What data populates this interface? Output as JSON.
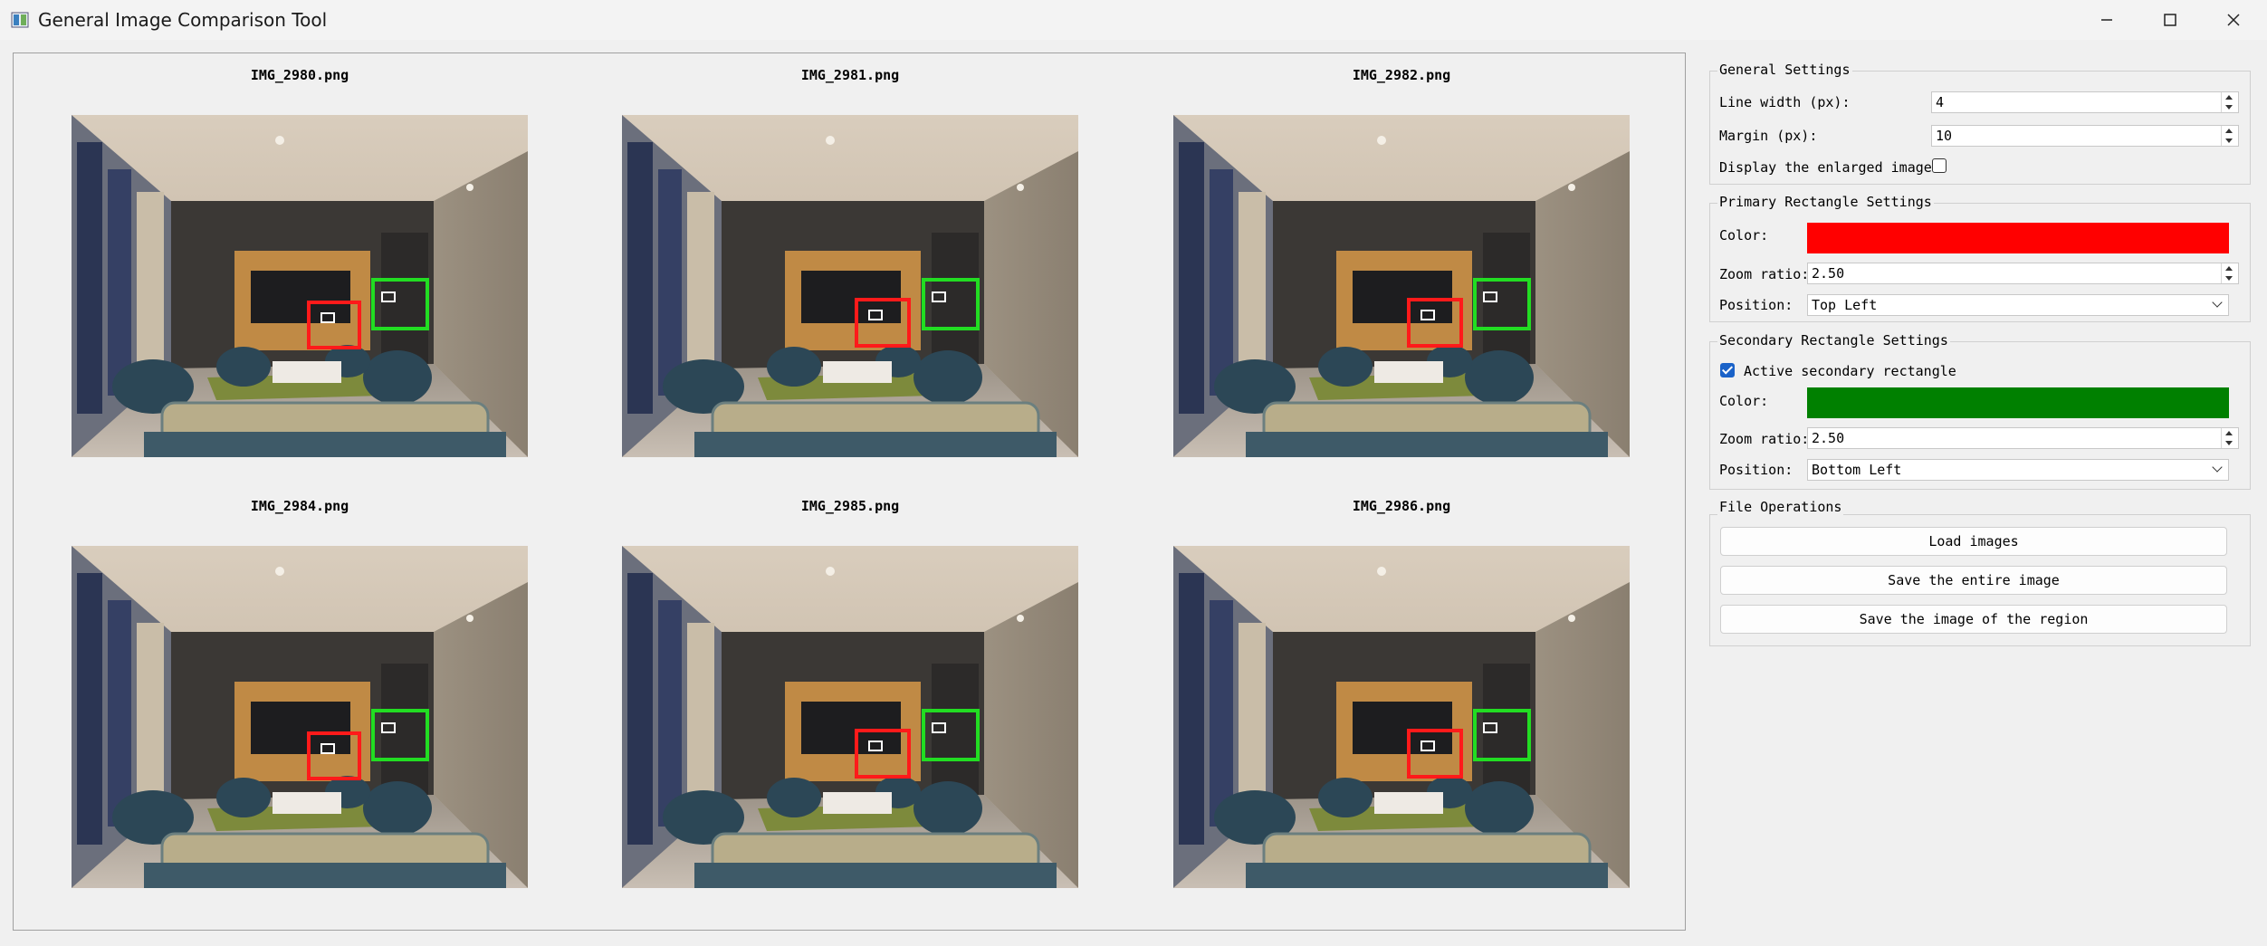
{
  "window": {
    "title": "General Image Comparison Tool"
  },
  "images": [
    {
      "name": "IMG_2980.png"
    },
    {
      "name": "IMG_2981.png"
    },
    {
      "name": "IMG_2982.png"
    },
    {
      "name": "IMG_2984.png"
    },
    {
      "name": "IMG_2985.png"
    },
    {
      "name": "IMG_2986.png"
    }
  ],
  "general_settings": {
    "title": "General Settings",
    "line_width_label": "Line width (px):",
    "line_width_value": "4",
    "margin_label": "Margin (px):",
    "margin_value": "10",
    "display_enlarged_label": "Display the enlarged image:",
    "display_enlarged_checked": false
  },
  "primary_rect": {
    "title": "Primary Rectangle Settings",
    "color_label": "Color:",
    "color": "#ff0000",
    "zoom_label": "Zoom ratio:",
    "zoom_value": "2.50",
    "position_label": "Position:",
    "position_value": "Top Left"
  },
  "secondary_rect": {
    "title": "Secondary Rectangle Settings",
    "active_label": "Active secondary rectangle",
    "active_checked": true,
    "color_label": "Color:",
    "color": "#008000",
    "zoom_label": "Zoom ratio:",
    "zoom_value": "2.50",
    "position_label": "Position:",
    "position_value": "Bottom Left"
  },
  "file_operations": {
    "title": "File Operations",
    "load_label": "Load images",
    "save_entire_label": "Save the entire image",
    "save_region_label": "Save the image of the region"
  },
  "colors": {
    "red_rect": "#ff1a1a",
    "green_rect": "#22dd22"
  }
}
